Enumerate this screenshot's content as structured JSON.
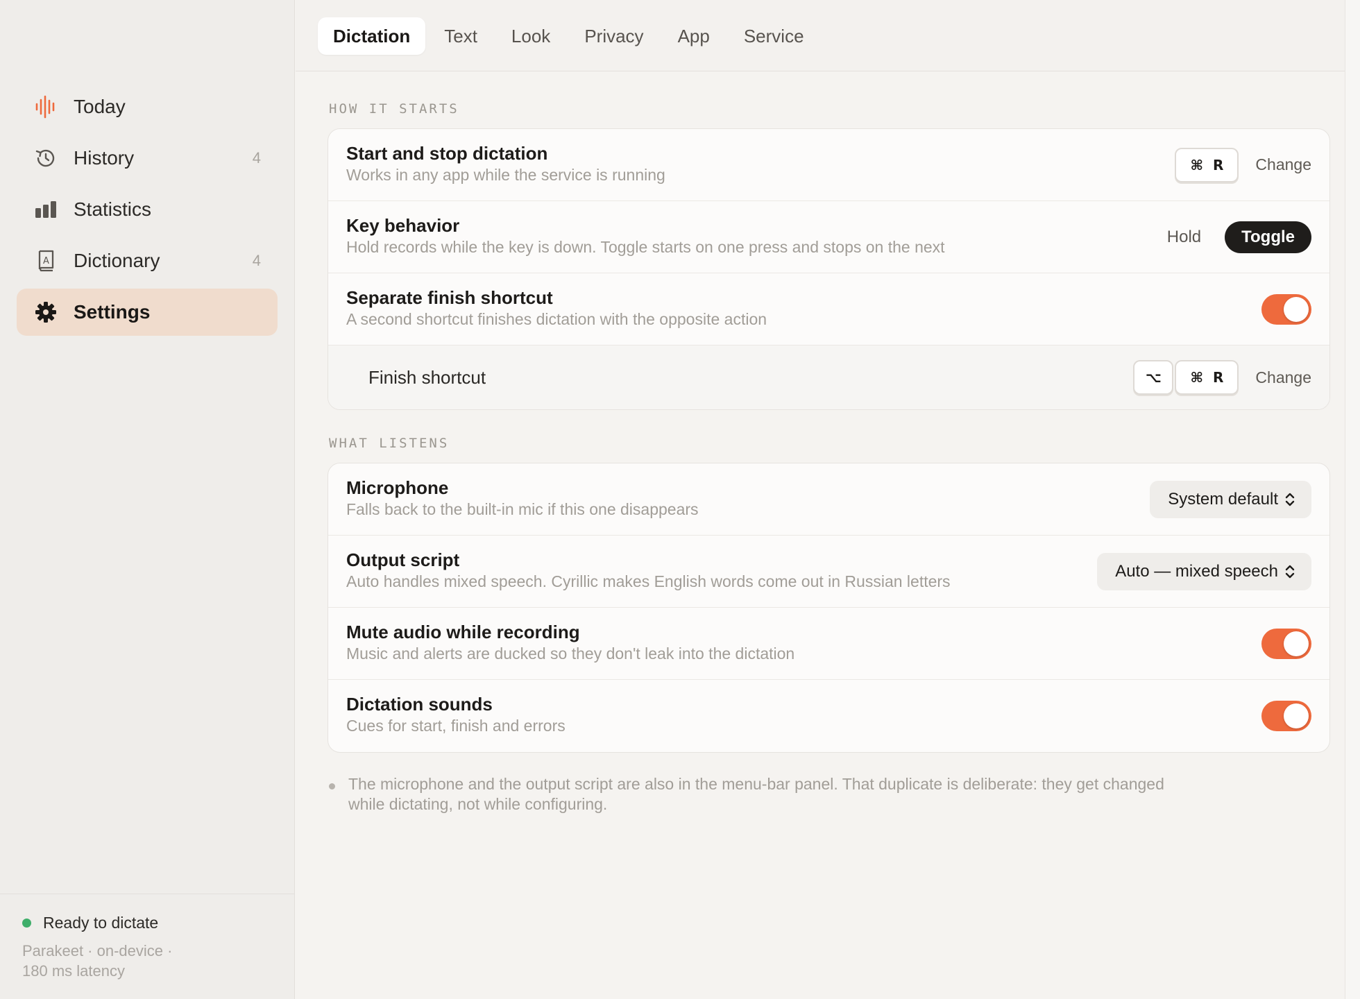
{
  "sidebar": {
    "items": [
      {
        "label": "Today",
        "icon": "waveform-icon",
        "badge": ""
      },
      {
        "label": "History",
        "icon": "history-icon",
        "badge": "4"
      },
      {
        "label": "Statistics",
        "icon": "bar-chart-icon",
        "badge": ""
      },
      {
        "label": "Dictionary",
        "icon": "dictionary-icon",
        "badge": "4"
      },
      {
        "label": "Settings",
        "icon": "gear-icon",
        "badge": ""
      }
    ],
    "active": "Settings",
    "status": {
      "text": "Ready to dictate",
      "detail_line1": "Parakeet · on-device ·",
      "detail_line2": "180 ms latency",
      "dot_color": "#3fae6a"
    }
  },
  "tabs": [
    "Dictation",
    "Text",
    "Look",
    "Privacy",
    "App",
    "Service"
  ],
  "active_tab": "Dictation",
  "sections": {
    "how": {
      "title": "HOW IT STARTS",
      "start_stop": {
        "title": "Start and stop dictation",
        "desc": "Works in any app while the service is running",
        "key_mod": "⌘",
        "key_letter": "R",
        "action": "Change"
      },
      "key_behavior": {
        "title": "Key behavior",
        "desc": "Hold records while the key is down. Toggle starts on one press and stops on the next",
        "option_hold": "Hold",
        "option_toggle": "Toggle",
        "selected": "Toggle"
      },
      "separate_finish": {
        "title": "Separate finish shortcut",
        "desc": "A second shortcut finishes dictation with the opposite action",
        "enabled": true
      },
      "finish_shortcut": {
        "title": "Finish shortcut",
        "key_alt": "⌥",
        "key_mod": "⌘",
        "key_letter": "R",
        "action": "Change"
      }
    },
    "listens": {
      "title": "WHAT LISTENS",
      "microphone": {
        "title": "Microphone",
        "desc": "Falls back to the built-in mic if this one disappears",
        "value": "System default"
      },
      "output_script": {
        "title": "Output script",
        "desc": "Auto handles mixed speech. Cyrillic makes English words come out in Russian letters",
        "value": "Auto — mixed speech"
      },
      "mute_audio": {
        "title": "Mute audio while recording",
        "desc": "Music and alerts are ducked so they don't leak into the dictation",
        "enabled": true
      },
      "sounds": {
        "title": "Dictation sounds",
        "desc": "Cues for start, finish and errors",
        "enabled": true
      }
    }
  },
  "note": "The microphone and the output script are also in the menu-bar panel. That duplicate is deliberate: they get changed while dictating, not while configuring.",
  "colors": {
    "accent": "#ee6a3d",
    "active_nav_bg": "#f0dccd",
    "status_ready": "#3fae6a"
  }
}
